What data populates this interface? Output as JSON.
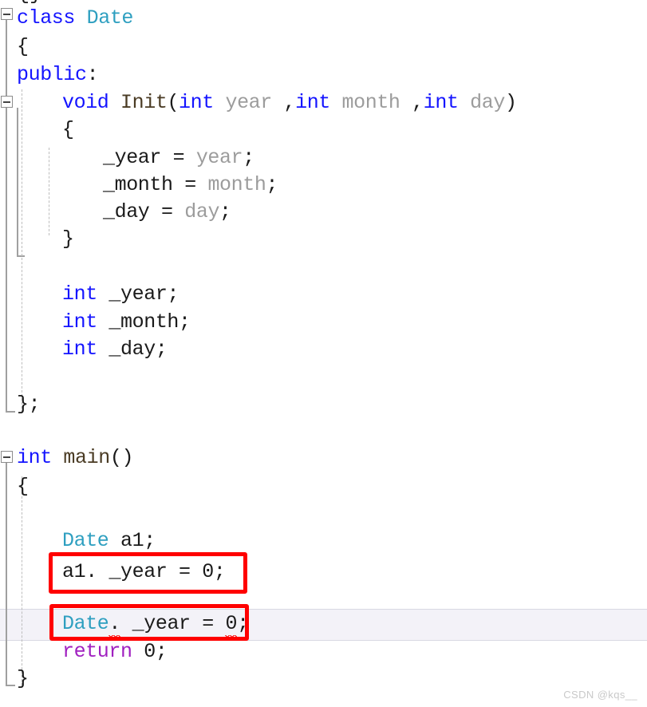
{
  "app": {
    "kind": "code-editor",
    "language": "C++",
    "theme_background": "#ffffff"
  },
  "colors": {
    "keyword": "#1414ff",
    "type": "#2e9fc0",
    "function": "#4a3b24",
    "parameter": "#9c9c9c",
    "return_keyword": "#a020c0",
    "text": "#1a1a1a",
    "error_squiggle": "#ff0000",
    "annotation_box": "#ff0000",
    "current_line_highlight": "#f3f2f8",
    "fold_gutter": "#a0a0a0",
    "indent_guide": "#bdbdbd",
    "watermark": "#c9c9c9"
  },
  "gutter": {
    "fold_boxes": [
      {
        "name": "fold-toggle-class-date",
        "glyph": "minus",
        "expanded": true
      },
      {
        "name": "fold-toggle-init-method",
        "glyph": "minus",
        "expanded": true
      },
      {
        "name": "fold-toggle-main-function",
        "glyph": "minus",
        "expanded": true
      }
    ]
  },
  "top_fragment": {
    "text": "{}"
  },
  "code": {
    "lines": [
      {
        "id": "line-class-date",
        "tokens": [
          {
            "text": "class ",
            "cls": "k"
          },
          {
            "text": "Date",
            "cls": "ty"
          }
        ]
      },
      {
        "id": "line-class-open-brace",
        "tokens": [
          {
            "text": "{",
            "cls": "op"
          }
        ]
      },
      {
        "id": "line-public",
        "tokens": [
          {
            "text": "public",
            "cls": "k"
          },
          {
            "text": ":",
            "cls": "op"
          }
        ]
      },
      {
        "id": "line-init-signature",
        "tokens": [
          {
            "text": "void ",
            "cls": "k"
          },
          {
            "text": "Init",
            "cls": "fn"
          },
          {
            "text": "(",
            "cls": "op"
          },
          {
            "text": "int ",
            "cls": "k"
          },
          {
            "text": "year ",
            "cls": "pm"
          },
          {
            "text": ",",
            "cls": "op"
          },
          {
            "text": "int ",
            "cls": "k"
          },
          {
            "text": "month ",
            "cls": "pm"
          },
          {
            "text": ",",
            "cls": "op"
          },
          {
            "text": "int ",
            "cls": "k"
          },
          {
            "text": "day",
            "cls": "pm"
          },
          {
            "text": ")",
            "cls": "op"
          }
        ]
      },
      {
        "id": "line-init-open-brace",
        "tokens": [
          {
            "text": "{",
            "cls": "op"
          }
        ]
      },
      {
        "id": "line-assign-year",
        "tokens": [
          {
            "text": "_year",
            "cls": "id"
          },
          {
            "text": " = ",
            "cls": "op"
          },
          {
            "text": "year",
            "cls": "pm"
          },
          {
            "text": ";",
            "cls": "op"
          }
        ]
      },
      {
        "id": "line-assign-month",
        "tokens": [
          {
            "text": "_month",
            "cls": "id"
          },
          {
            "text": " = ",
            "cls": "op"
          },
          {
            "text": "month",
            "cls": "pm"
          },
          {
            "text": ";",
            "cls": "op"
          }
        ]
      },
      {
        "id": "line-assign-day",
        "tokens": [
          {
            "text": "_day",
            "cls": "id"
          },
          {
            "text": " = ",
            "cls": "op"
          },
          {
            "text": "day",
            "cls": "pm"
          },
          {
            "text": ";",
            "cls": "op"
          }
        ]
      },
      {
        "id": "line-init-close-brace",
        "tokens": [
          {
            "text": "}",
            "cls": "op"
          }
        ]
      },
      {
        "id": "line-member-year",
        "tokens": [
          {
            "text": "int ",
            "cls": "k"
          },
          {
            "text": "_year",
            "cls": "id"
          },
          {
            "text": ";",
            "cls": "op"
          }
        ]
      },
      {
        "id": "line-member-month",
        "tokens": [
          {
            "text": "int ",
            "cls": "k"
          },
          {
            "text": "_month",
            "cls": "id"
          },
          {
            "text": ";",
            "cls": "op"
          }
        ]
      },
      {
        "id": "line-member-day",
        "tokens": [
          {
            "text": "int ",
            "cls": "k"
          },
          {
            "text": "_day",
            "cls": "id"
          },
          {
            "text": ";",
            "cls": "op"
          }
        ]
      },
      {
        "id": "line-class-close",
        "tokens": [
          {
            "text": "};",
            "cls": "op"
          }
        ]
      },
      {
        "id": "line-main-signature",
        "tokens": [
          {
            "text": "int ",
            "cls": "k"
          },
          {
            "text": "main",
            "cls": "fn"
          },
          {
            "text": "()",
            "cls": "op"
          }
        ]
      },
      {
        "id": "line-main-open-brace",
        "tokens": [
          {
            "text": "{",
            "cls": "op"
          }
        ]
      },
      {
        "id": "line-decl-a1",
        "tokens": [
          {
            "text": "Date ",
            "cls": "ty"
          },
          {
            "text": "a1",
            "cls": "id",
            "squiggle": true
          },
          {
            "text": ";",
            "cls": "op"
          }
        ]
      },
      {
        "id": "line-a1-year-assign",
        "tokens": [
          {
            "text": "a1",
            "cls": "id"
          },
          {
            "text": ". ",
            "cls": "op"
          },
          {
            "text": "_year",
            "cls": "id"
          },
          {
            "text": " = ",
            "cls": "op"
          },
          {
            "text": "0",
            "cls": "nm"
          },
          {
            "text": ";",
            "cls": "op"
          }
        ]
      },
      {
        "id": "line-date-year-assign",
        "tokens": [
          {
            "text": "Date",
            "cls": "ty"
          },
          {
            "text": ".",
            "cls": "op",
            "squiggle": true
          },
          {
            "text": " _year",
            "cls": "id"
          },
          {
            "text": " = ",
            "cls": "op"
          },
          {
            "text": "0",
            "cls": "nm",
            "squiggle": true
          },
          {
            "text": ";",
            "cls": "op"
          }
        ]
      },
      {
        "id": "line-return",
        "tokens": [
          {
            "text": "return ",
            "cls": "rt"
          },
          {
            "text": "0",
            "cls": "nm"
          },
          {
            "text": ";",
            "cls": "op"
          }
        ]
      },
      {
        "id": "line-main-close-brace",
        "tokens": [
          {
            "text": "}",
            "cls": "op"
          }
        ]
      }
    ]
  },
  "annotations": {
    "boxes": [
      {
        "name": "annotation-box-a1-member-access",
        "target_line": "line-a1-year-assign"
      },
      {
        "name": "annotation-box-date-member-access",
        "target_line": "line-date-year-assign"
      }
    ]
  },
  "watermark": {
    "text": "CSDN @kqs__"
  }
}
